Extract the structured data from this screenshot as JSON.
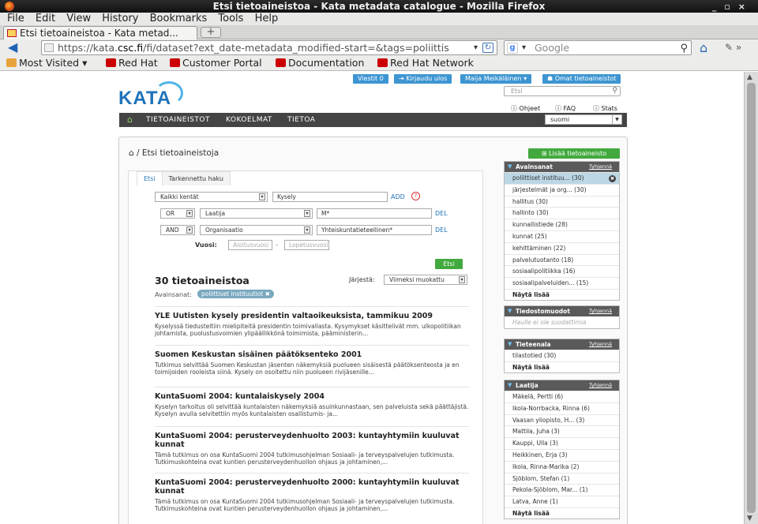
{
  "window": {
    "title": "Etsi tietoaineistoa - Kata metadata catalogue - Mozilla Firefox"
  },
  "menu": [
    "File",
    "Edit",
    "View",
    "History",
    "Bookmarks",
    "Tools",
    "Help"
  ],
  "tab": {
    "label": "Etsi tietoaineistoa - Kata metad...",
    "new_tab": "+"
  },
  "url": {
    "prefix": "https://kata.",
    "domain": "csc.fi",
    "rest": "/fi/dataset?ext_date-metadata_modified-start=&tags=poliittis"
  },
  "search_engine": {
    "placeholder": "Google"
  },
  "bookmarks": [
    "Most Visited",
    "Red Hat",
    "Customer Portal",
    "Documentation",
    "Red Hat Network"
  ],
  "site": {
    "logo_text": "KATA",
    "top_buttons": [
      "Viestit 0",
      "Kirjaudu ulos",
      "Maija Meikäläinen",
      "Omat tietoaineistot"
    ],
    "search_placeholder": "Etsi",
    "help_links": [
      "Ohjeet",
      "FAQ",
      "Stats"
    ],
    "nav": [
      "TIETOAINEISTOT",
      "KOKOELMAT",
      "TIETOA"
    ],
    "language": "suomi"
  },
  "page": {
    "breadcrumb": "/ Etsi tietoaineistoja",
    "add_button": "Lisää tietoaineisto",
    "tabs": [
      "Etsi",
      "Tarkennettu haku"
    ],
    "adv": {
      "field1": "Kaikki kentät",
      "value1": "Kysely",
      "add_link": "ADD",
      "help": "?",
      "op2": "OR",
      "field2": "Laatija",
      "value2": "M*",
      "del2": "DEL",
      "op3": "AND",
      "field3": "Organisaatio",
      "value3": "Yhteiskuntatieteellinen*",
      "del3": "DEL",
      "years_label": "Vuosi:",
      "from_placeholder": "Aloitusvuosi",
      "dash": "-",
      "to_placeholder": "Lopetusvuosi",
      "search_button": "Etsi"
    },
    "results_count": "30 tietoaineistoa",
    "sort_label": "Järjestä:",
    "sort_value": "Viimeksi muokattu",
    "filter_label": "Avainsanat:",
    "filter_pill": "poliittiset instituutiot",
    "results": [
      {
        "title": "YLE Uutisten kysely presidentin valtaoikeuksista, tammikuu 2009",
        "desc": "Kyselyssä tiedusteltiin mielipiteitä presidentin toimivallasta. Kysymykset käsittelivät mm. ulkopolitiikan johtamista, puolustusvoimien ylipäällikkönä toimimista, pääministerin..."
      },
      {
        "title": "Suomen Keskustan sisäinen päätöksenteko 2001",
        "desc": "Tutkimus selvittää Suomen Keskustan jäsenten näkemyksiä puolueen sisäisestä päätöksenteosta ja en toimijoiden rooleista siinä. Kysely on osoitettu niin puolueen rivijäsenille..."
      },
      {
        "title": "KuntaSuomi 2004: kuntalaiskysely 2004",
        "desc": "Kyselyn tarkoitus oli selvittää kuntalaisten näkemyksiä asuinkunnastaan, sen palveluista sekä päättäjistä. Kyselyn avulla selvitettiin myös kuntalaisten osallistumis- ja..."
      },
      {
        "title": "KuntaSuomi 2004: perusterveydenhuolto 2003: kuntayhtymiin kuuluvat kunnat",
        "desc": "Tämä tutkimus on osa KuntaSuomi 2004 tutkimusohjelman Sosiaali- ja terveyspalvelujen tutkimusta. Tutkimuskohteina ovat kuntien perusterveydenhuollon ohjaus ja johtaminen,..."
      },
      {
        "title": "KuntaSuomi 2004: perusterveydenhuolto 2000: kuntayhtymiin kuuluvat kunnat",
        "desc": "Tämä tutkimus on osa KuntaSuomi 2004 tutkimusohjelman Sosiaali- ja terveyspalvelujen tutkimusta. Tutkimuskohteina ovat kuntien perusterveydenhuollon ohjaus ja johtaminen,..."
      }
    ]
  },
  "facets": {
    "keywords": {
      "title": "Avainsanat",
      "clear": "Tyhjennä",
      "items": [
        "poliittiset instituu... (30)",
        "järjestelmät ja org... (30)",
        "hallitus (30)",
        "hallinto (30)",
        "kunnallistiede (28)",
        "kunnat (25)",
        "kehittäminen (22)",
        "palvelutuotanto (18)",
        "sosiaalipolitiikka (16)",
        "sosiaalipalveluiden... (15)"
      ],
      "more": "Näytä lisää"
    },
    "formats": {
      "title": "Tiedostomuodot",
      "clear": "Tyhjennä",
      "empty": "Haulle ei ole suodattimia"
    },
    "field": {
      "title": "Tieteenala",
      "clear": "Tyhjennä",
      "items": [
        "tilastotied (30)"
      ],
      "more": "Näytä lisää"
    },
    "author": {
      "title": "Laatija",
      "clear": "Tyhjennä",
      "items": [
        "Mäkelä, Pertti (6)",
        "Ikola-Norrbacka, Rinna (6)",
        "Vaasan yliopisto, H... (3)",
        "Mattila, Juha (3)",
        "Kauppi, Ulla (3)",
        "Heikkinen, Erja (3)",
        "Ikola, Rinna-Marika (2)",
        "Sjöblom, Stefan (1)",
        "Pekola-Sjöblom, Mar... (1)",
        "Latva, Anne (1)"
      ],
      "more": "Näytä lisää"
    }
  }
}
